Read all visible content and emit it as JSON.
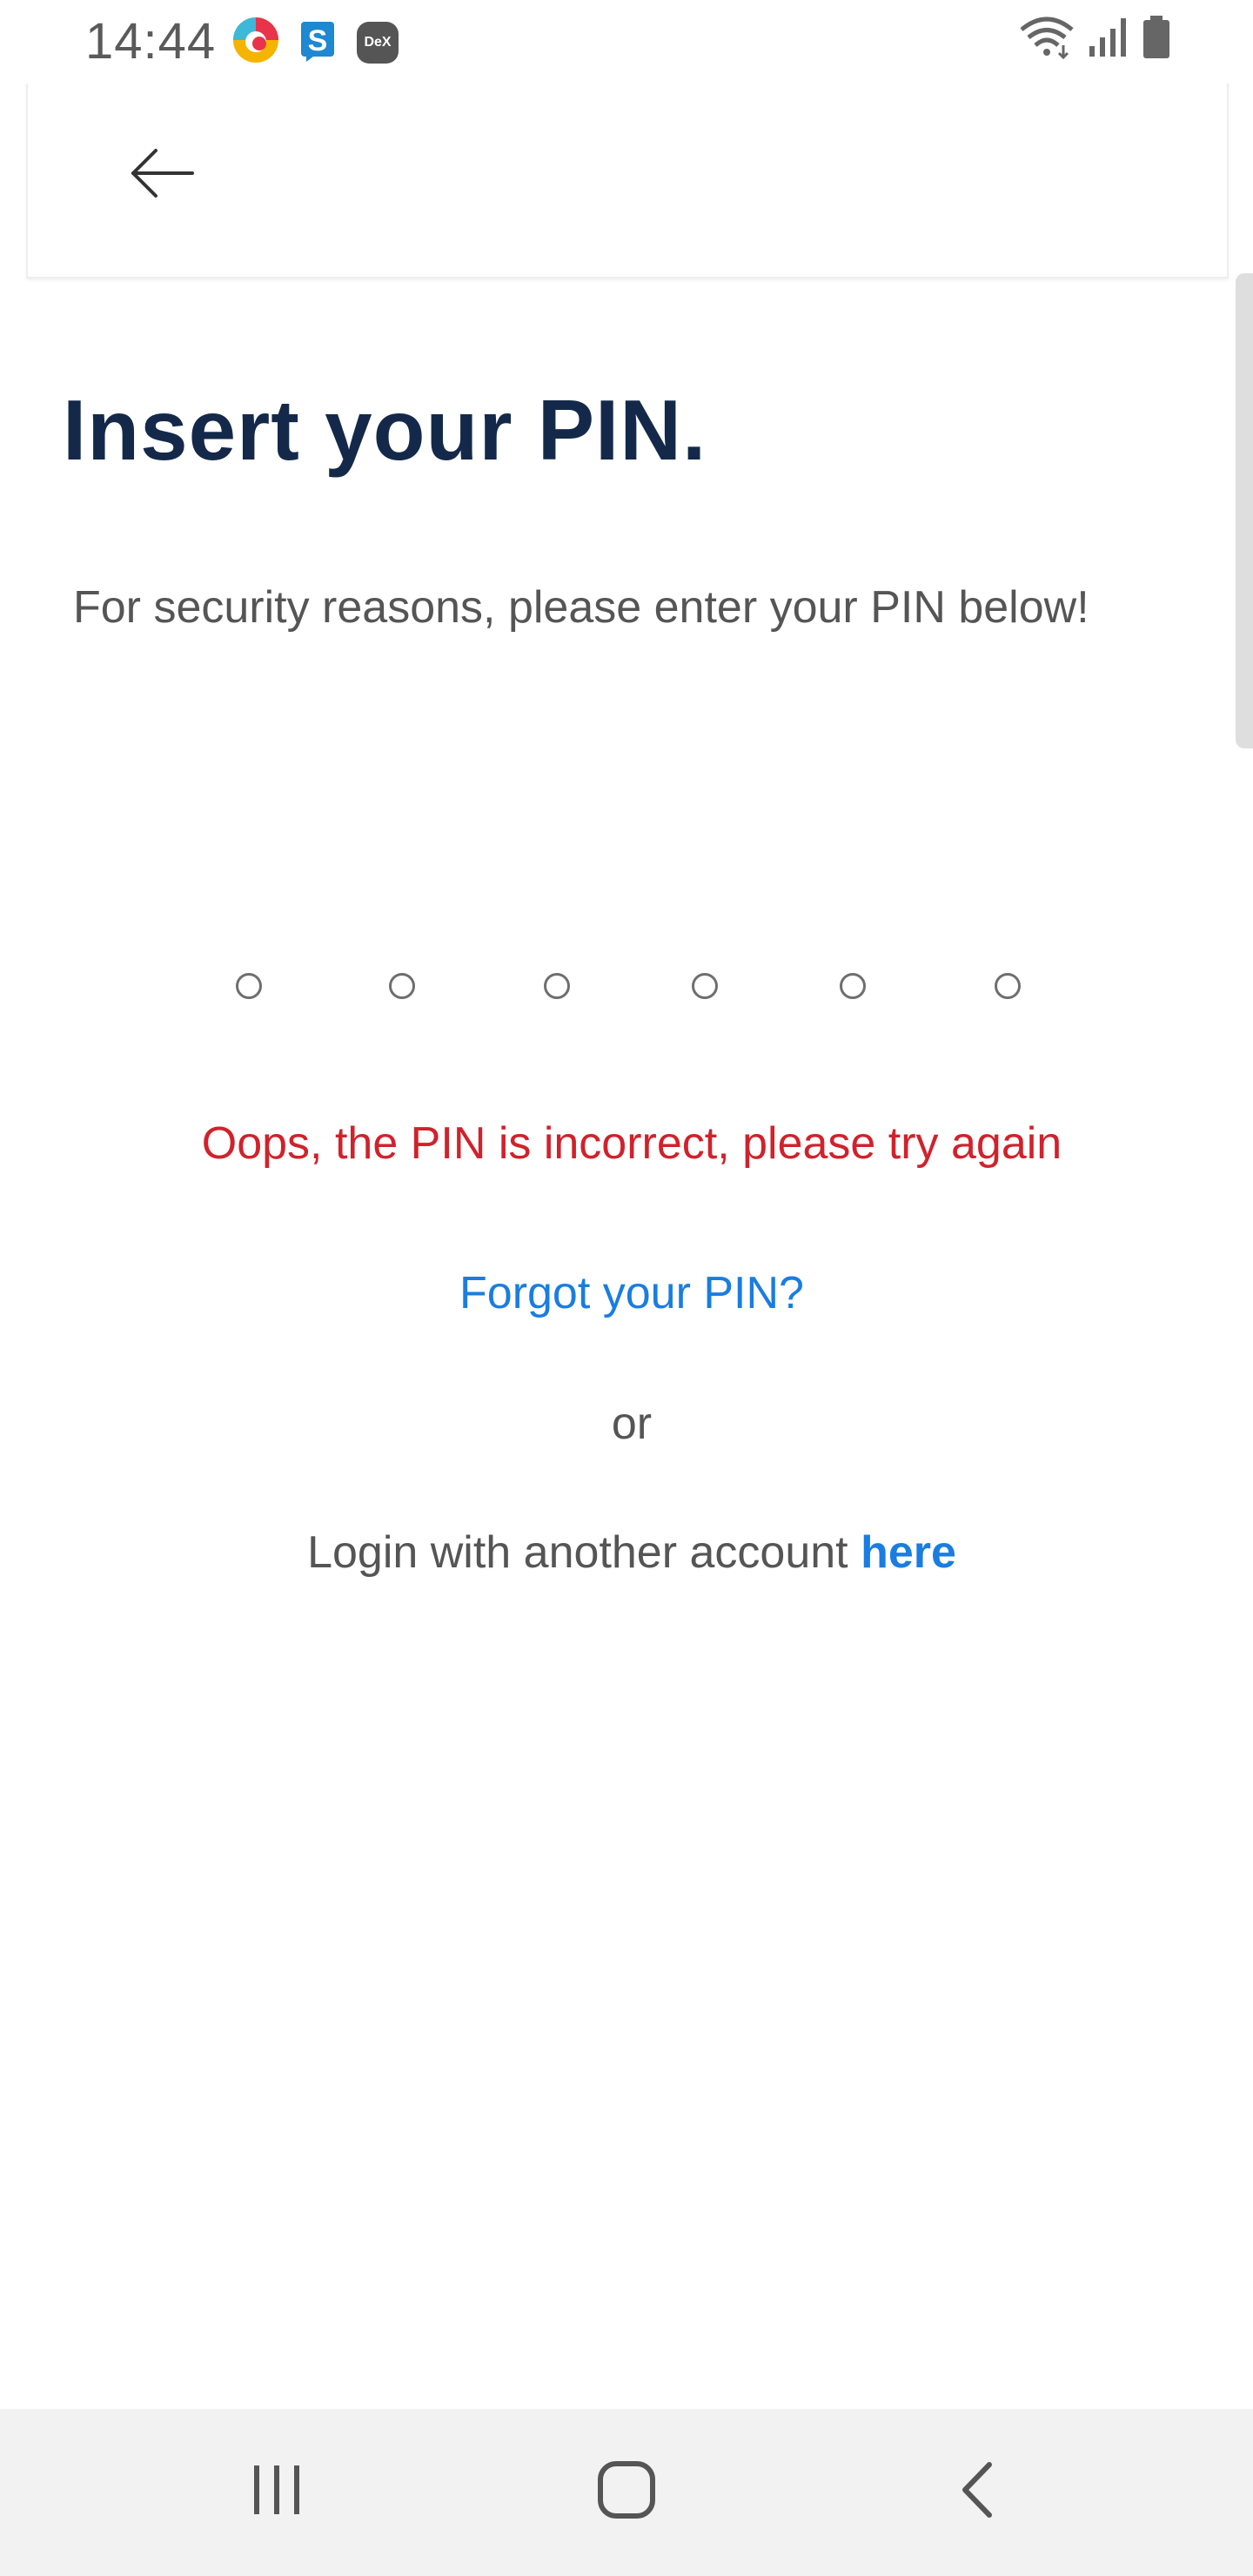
{
  "status_bar": {
    "time": "14:44",
    "dex_label": "DeX"
  },
  "content": {
    "title": "Insert your PIN.",
    "subtitle": "For security reasons, please enter your PIN below!",
    "pin_length": 6,
    "error_message": "Oops, the PIN is incorrect, please try again",
    "forgot_pin_link": "Forgot your PIN?",
    "or_text": "or",
    "login_prefix": "Login with another account",
    "login_link": "here"
  },
  "colors": {
    "title": "#14294a",
    "error": "#d0222c",
    "link": "#1a7de0",
    "body_text": "#555555"
  },
  "icons": {
    "back": "arrow-left-icon",
    "nav_recent": "recent-apps-icon",
    "nav_home": "home-icon",
    "nav_back": "chevron-left-icon"
  }
}
